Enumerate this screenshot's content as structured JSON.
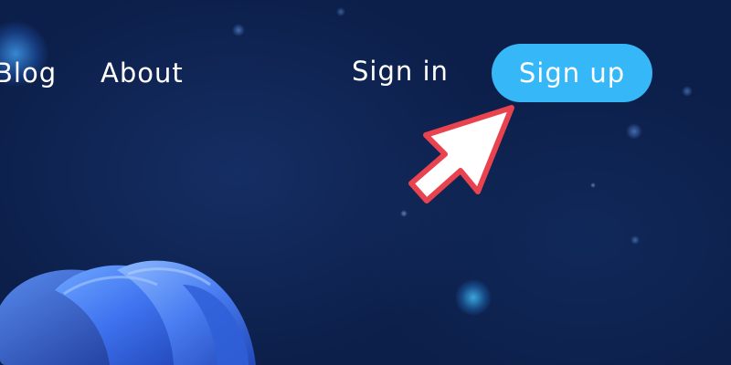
{
  "nav": {
    "blog_label": "Blog",
    "about_label": "About",
    "signin_label": "Sign in",
    "signup_label": "Sign up"
  },
  "icons": {
    "pointer": "arrow-pointer-icon",
    "decoration": "bloom-shape"
  },
  "colors": {
    "background": "#0c1f4a",
    "signup_button": "#36b7f7",
    "arrow_fill": "#ffffff",
    "arrow_outline": "#e8434f",
    "text": "#ffffff"
  }
}
